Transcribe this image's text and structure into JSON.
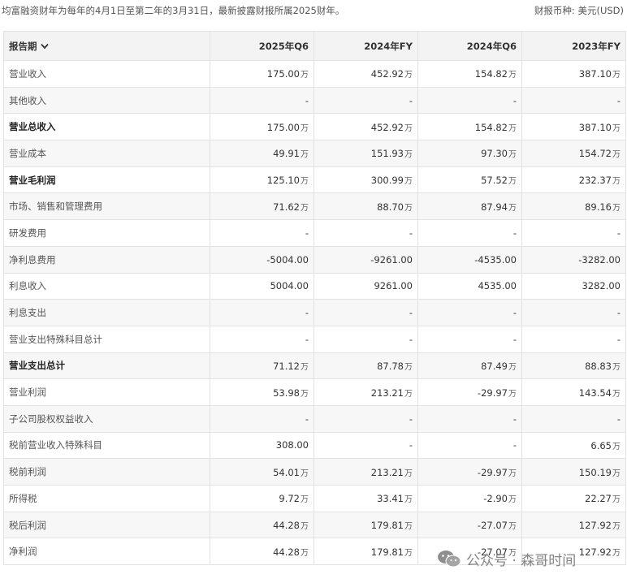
{
  "header": {
    "fiscal_note": "均富融资财年为每年的4月1日至第二年的3月31日，最新披露财报所属2025财年。",
    "currency_label": "财报币种:",
    "currency_value": "美元(USD)"
  },
  "table": {
    "period_label": "报告期",
    "columns": [
      "2025年Q6",
      "2024年FY",
      "2024年Q6",
      "2023年FY"
    ],
    "rows": [
      {
        "label": "营业收入",
        "bold": false,
        "values": [
          {
            "v": "175.00",
            "u": "万"
          },
          {
            "v": "452.92",
            "u": "万"
          },
          {
            "v": "154.82",
            "u": "万"
          },
          {
            "v": "387.10",
            "u": "万"
          }
        ]
      },
      {
        "label": "其他收入",
        "bold": false,
        "values": [
          {
            "v": "-",
            "u": ""
          },
          {
            "v": "-",
            "u": ""
          },
          {
            "v": "-",
            "u": ""
          },
          {
            "v": "-",
            "u": ""
          }
        ]
      },
      {
        "label": "营业总收入",
        "bold": true,
        "values": [
          {
            "v": "175.00",
            "u": "万"
          },
          {
            "v": "452.92",
            "u": "万"
          },
          {
            "v": "154.82",
            "u": "万"
          },
          {
            "v": "387.10",
            "u": "万"
          }
        ]
      },
      {
        "label": "营业成本",
        "bold": false,
        "values": [
          {
            "v": "49.91",
            "u": "万"
          },
          {
            "v": "151.93",
            "u": "万"
          },
          {
            "v": "97.30",
            "u": "万"
          },
          {
            "v": "154.72",
            "u": "万"
          }
        ]
      },
      {
        "label": "营业毛利润",
        "bold": true,
        "values": [
          {
            "v": "125.10",
            "u": "万"
          },
          {
            "v": "300.99",
            "u": "万"
          },
          {
            "v": "57.52",
            "u": "万"
          },
          {
            "v": "232.37",
            "u": "万"
          }
        ]
      },
      {
        "label": "市场、销售和管理费用",
        "bold": false,
        "values": [
          {
            "v": "71.62",
            "u": "万"
          },
          {
            "v": "88.70",
            "u": "万"
          },
          {
            "v": "87.94",
            "u": "万"
          },
          {
            "v": "89.16",
            "u": "万"
          }
        ]
      },
      {
        "label": "研发费用",
        "bold": false,
        "values": [
          {
            "v": "-",
            "u": ""
          },
          {
            "v": "-",
            "u": ""
          },
          {
            "v": "-",
            "u": ""
          },
          {
            "v": "-",
            "u": ""
          }
        ]
      },
      {
        "label": "净利息费用",
        "bold": false,
        "values": [
          {
            "v": "-5004.00",
            "u": ""
          },
          {
            "v": "-9261.00",
            "u": ""
          },
          {
            "v": "-4535.00",
            "u": ""
          },
          {
            "v": "-3282.00",
            "u": ""
          }
        ]
      },
      {
        "label": "利息收入",
        "bold": false,
        "values": [
          {
            "v": "5004.00",
            "u": ""
          },
          {
            "v": "9261.00",
            "u": ""
          },
          {
            "v": "4535.00",
            "u": ""
          },
          {
            "v": "3282.00",
            "u": ""
          }
        ]
      },
      {
        "label": "利息支出",
        "bold": false,
        "values": [
          {
            "v": "-",
            "u": ""
          },
          {
            "v": "-",
            "u": ""
          },
          {
            "v": "-",
            "u": ""
          },
          {
            "v": "-",
            "u": ""
          }
        ]
      },
      {
        "label": "营业支出特殊科目总计",
        "bold": false,
        "values": [
          {
            "v": "-",
            "u": ""
          },
          {
            "v": "-",
            "u": ""
          },
          {
            "v": "-",
            "u": ""
          },
          {
            "v": "-",
            "u": ""
          }
        ]
      },
      {
        "label": "营业支出总计",
        "bold": true,
        "values": [
          {
            "v": "71.12",
            "u": "万"
          },
          {
            "v": "87.78",
            "u": "万"
          },
          {
            "v": "87.49",
            "u": "万"
          },
          {
            "v": "88.83",
            "u": "万"
          }
        ]
      },
      {
        "label": "营业利润",
        "bold": false,
        "values": [
          {
            "v": "53.98",
            "u": "万"
          },
          {
            "v": "213.21",
            "u": "万"
          },
          {
            "v": "-29.97",
            "u": "万"
          },
          {
            "v": "143.54",
            "u": "万"
          }
        ]
      },
      {
        "label": "子公司股权权益收入",
        "bold": false,
        "values": [
          {
            "v": "-",
            "u": ""
          },
          {
            "v": "-",
            "u": ""
          },
          {
            "v": "-",
            "u": ""
          },
          {
            "v": "-",
            "u": ""
          }
        ]
      },
      {
        "label": "税前营业收入特殊科目",
        "bold": false,
        "values": [
          {
            "v": "308.00",
            "u": ""
          },
          {
            "v": "-",
            "u": ""
          },
          {
            "v": "-",
            "u": ""
          },
          {
            "v": "6.65",
            "u": "万"
          }
        ]
      },
      {
        "label": "税前利润",
        "bold": false,
        "values": [
          {
            "v": "54.01",
            "u": "万"
          },
          {
            "v": "213.21",
            "u": "万"
          },
          {
            "v": "-29.97",
            "u": "万"
          },
          {
            "v": "150.19",
            "u": "万"
          }
        ]
      },
      {
        "label": "所得税",
        "bold": false,
        "values": [
          {
            "v": "9.72",
            "u": "万"
          },
          {
            "v": "33.41",
            "u": "万"
          },
          {
            "v": "-2.90",
            "u": "万"
          },
          {
            "v": "22.27",
            "u": "万"
          }
        ]
      },
      {
        "label": "税后利润",
        "bold": false,
        "values": [
          {
            "v": "44.28",
            "u": "万"
          },
          {
            "v": "179.81",
            "u": "万"
          },
          {
            "v": "-27.07",
            "u": "万"
          },
          {
            "v": "127.92",
            "u": "万"
          }
        ]
      },
      {
        "label": "净利润",
        "bold": false,
        "values": [
          {
            "v": "44.28",
            "u": "万"
          },
          {
            "v": "179.81",
            "u": "万"
          },
          {
            "v": "-27.07",
            "u": "万"
          },
          {
            "v": "127.92",
            "u": "万"
          }
        ]
      }
    ]
  },
  "watermark": {
    "icon": "wechat-icon",
    "text": "公众号 · 森哥时间"
  },
  "colors": {
    "header_bg": "#f3f3f3",
    "alt_row_bg": "#f7f7f7",
    "border": "#e2e2e2",
    "text": "#333333"
  }
}
